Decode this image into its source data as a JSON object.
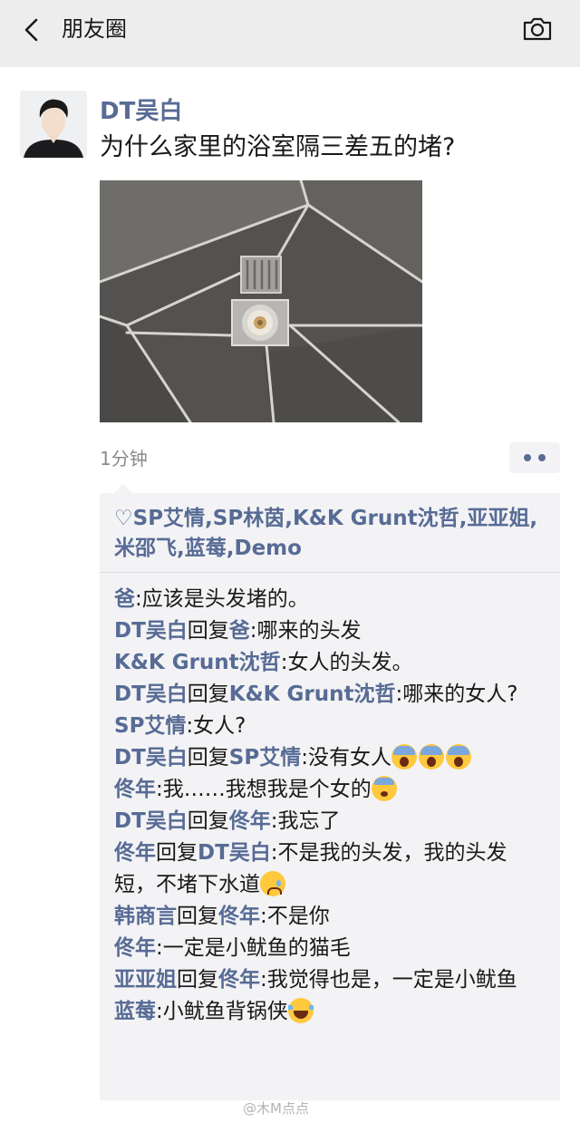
{
  "nav": {
    "title": "朋友圈",
    "back_icon": "chevron-left-icon",
    "camera_icon": "camera-icon",
    "bar_color": "#ededed"
  },
  "post": {
    "author": "DT吴白",
    "text": "为什么家里的浴室隔三差五的堵?",
    "time": "1分钟",
    "more_icon": "more-dots-icon",
    "link_color": "#576b95"
  },
  "likes": {
    "icon": "heart-outline-icon",
    "heart": "♡",
    "names": "SP艾情,SP林茵,K&K Grunt沈哲,亚亚姐,米邵飞,蓝莓,Demo"
  },
  "comments": [
    {
      "from": "爸",
      "reply": "",
      "to": "",
      "text": "应该是头发堵的。",
      "emoji": []
    },
    {
      "from": "DT吴白",
      "reply": "回复",
      "to": "爸",
      "text": "哪来的头发",
      "emoji": []
    },
    {
      "from": "K&K Grunt沈哲",
      "reply": "",
      "to": "",
      "text": "女人的头发。",
      "emoji": []
    },
    {
      "from": "DT吴白",
      "reply": "回复",
      "to": "K&K Grunt沈哲",
      "text": "哪来的女人?",
      "emoji": []
    },
    {
      "from": "SP艾情",
      "reply": "",
      "to": "",
      "text": "女人?",
      "emoji": []
    },
    {
      "from": "DT吴白",
      "reply": "回复",
      "to": "SP艾情",
      "text": "没有女人",
      "emoji": [
        "scream",
        "scream",
        "scream"
      ]
    },
    {
      "from": "佟年",
      "reply": "",
      "to": "",
      "text": "我……我想我是个女的",
      "emoji": [
        "fear"
      ]
    },
    {
      "from": "DT吴白",
      "reply": "回复",
      "to": "佟年",
      "text": "我忘了",
      "emoji": []
    },
    {
      "from": "佟年",
      "reply": "回复",
      "to": "DT吴白",
      "text": "不是我的头发，我的头发短，不堵下水道",
      "emoji": [
        "sad"
      ]
    },
    {
      "from": "韩商言",
      "reply": "回复",
      "to": "佟年",
      "text": "不是你",
      "emoji": []
    },
    {
      "from": "佟年",
      "reply": "",
      "to": "",
      "text": "一定是小鱿鱼的猫毛",
      "emoji": []
    },
    {
      "from": "亚亚姐",
      "reply": "回复",
      "to": "佟年",
      "text": "我觉得也是，一定是小鱿鱼",
      "emoji": []
    },
    {
      "from": "蓝莓",
      "reply": "",
      "to": "",
      "text": "小鱿鱼背锅侠",
      "emoji": [
        "laugh"
      ]
    }
  ],
  "watermark": "@木M点点"
}
